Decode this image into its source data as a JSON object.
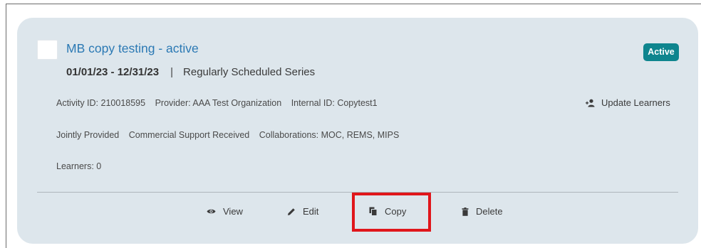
{
  "activity": {
    "title": "MB copy testing - active",
    "dates": "01/01/23 - 12/31/23",
    "separator": "|",
    "type": "Regularly Scheduled Series",
    "status": "Active",
    "activity_id": "Activity ID: 210018595",
    "provider": "Provider: AAA Test Organization",
    "internal_id": "Internal ID: Copytest1",
    "jointly_provided": "Jointly Provided",
    "commercial_support": "Commercial Support Received",
    "collaborations": "Collaborations: MOC, REMS, MIPS",
    "learners": "Learners: 0"
  },
  "update_learners": {
    "label": "Update Learners",
    "icon": "user-plus-icon"
  },
  "actions": {
    "view": {
      "label": "View",
      "icon": "eye-icon"
    },
    "edit": {
      "label": "Edit",
      "icon": "pencil-icon"
    },
    "copy": {
      "label": "Copy",
      "icon": "copy-icon"
    },
    "delete": {
      "label": "Delete",
      "icon": "trash-icon"
    }
  },
  "colors": {
    "card_bg": "#dde6ec",
    "title_link": "#2b79b4",
    "badge_bg": "#0e858e",
    "highlight_border": "#e0161b"
  }
}
